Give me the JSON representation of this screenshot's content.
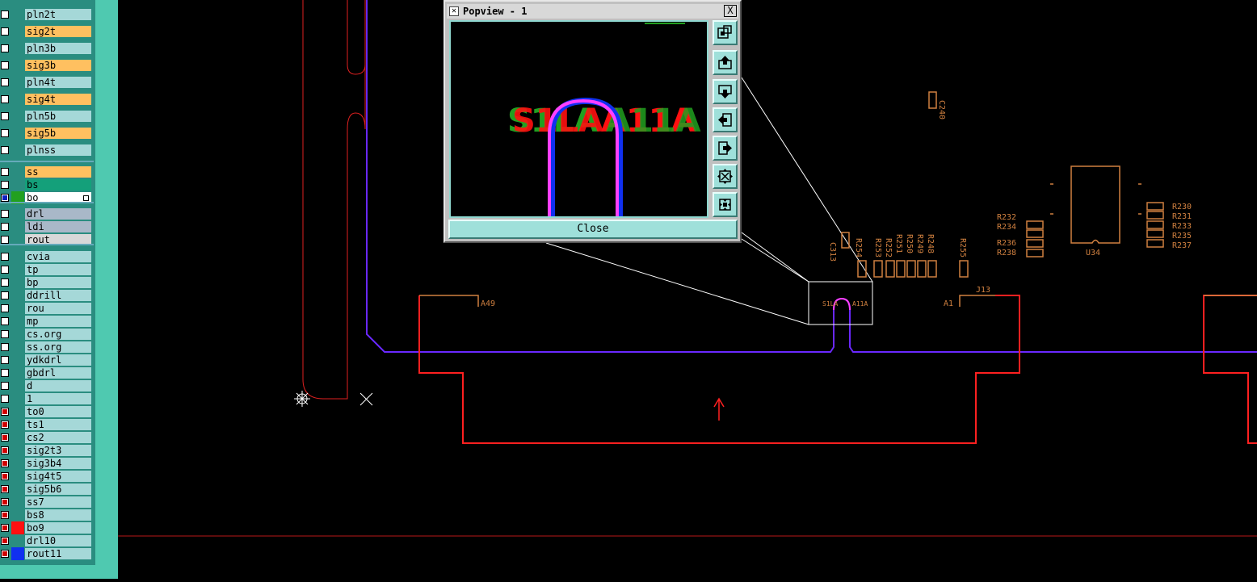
{
  "layers": [
    {
      "name": "pln2t",
      "fill": "#a5d8d8",
      "check": "white"
    },
    {
      "name": "sig2t",
      "fill": "#ffc060",
      "check": "white"
    },
    {
      "name": "pln3b",
      "fill": "#a5d8d8",
      "check": "white"
    },
    {
      "name": "sig3b",
      "fill": "#ffc060",
      "check": "white"
    },
    {
      "name": "pln4t",
      "fill": "#a5d8d8",
      "check": "white"
    },
    {
      "name": "sig4t",
      "fill": "#ffc060",
      "check": "white"
    },
    {
      "name": "pln5b",
      "fill": "#a5d8d8",
      "check": "white"
    },
    {
      "name": "sig5b",
      "fill": "#ffc060",
      "check": "white"
    },
    {
      "name": "plnss",
      "fill": "#a5d8d8",
      "check": "white"
    },
    {
      "name": "ss",
      "fill": "#ffc060",
      "check": "white"
    },
    {
      "name": "bs",
      "fill": "#14a07a",
      "check": "white"
    },
    {
      "name": "bo",
      "fill": "#ffffff",
      "check": "blue",
      "swatch": "#22a020"
    },
    {
      "name": "drl",
      "fill": "#a9b8c8",
      "check": "white"
    },
    {
      "name": "ldi",
      "fill": "#a9b8c8",
      "check": "white"
    },
    {
      "name": "rout",
      "fill": "#d8d8d8",
      "check": "white"
    },
    {
      "name": "cvia",
      "fill": "#a5d8d8",
      "check": "white"
    },
    {
      "name": "tp",
      "fill": "#a5d8d8",
      "check": "white"
    },
    {
      "name": "bp",
      "fill": "#a5d8d8",
      "check": "white"
    },
    {
      "name": "ddrill",
      "fill": "#a5d8d8",
      "check": "white"
    },
    {
      "name": "rou",
      "fill": "#a5d8d8",
      "check": "white"
    },
    {
      "name": "mp",
      "fill": "#a5d8d8",
      "check": "white"
    },
    {
      "name": "cs.org",
      "fill": "#a5d8d8",
      "check": "white"
    },
    {
      "name": "ss.org",
      "fill": "#a5d8d8",
      "check": "white"
    },
    {
      "name": "ydkdrl",
      "fill": "#a5d8d8",
      "check": "white"
    },
    {
      "name": "gbdrl",
      "fill": "#a5d8d8",
      "check": "white"
    },
    {
      "name": "d",
      "fill": "#a5d8d8",
      "check": "white"
    },
    {
      "name": "1",
      "fill": "#a5d8d8",
      "check": "white"
    },
    {
      "name": "to0",
      "fill": "#a5d8d8",
      "check": "red"
    },
    {
      "name": "ts1",
      "fill": "#a5d8d8",
      "check": "red"
    },
    {
      "name": "cs2",
      "fill": "#a5d8d8",
      "check": "red"
    },
    {
      "name": "sig2t3",
      "fill": "#a5d8d8",
      "check": "red"
    },
    {
      "name": "sig3b4",
      "fill": "#a5d8d8",
      "check": "red"
    },
    {
      "name": "sig4t5",
      "fill": "#a5d8d8",
      "check": "red"
    },
    {
      "name": "sig5b6",
      "fill": "#a5d8d8",
      "check": "red"
    },
    {
      "name": "ss7",
      "fill": "#a5d8d8",
      "check": "red"
    },
    {
      "name": "bs8",
      "fill": "#a5d8d8",
      "check": "red"
    },
    {
      "name": "bo9",
      "fill": "#a5d8d8",
      "check": "red",
      "swatch": "#ff1010"
    },
    {
      "name": "drl10",
      "fill": "#a5d8d8",
      "check": "red"
    },
    {
      "name": "rout11",
      "fill": "#a5d8d8",
      "check": "red",
      "swatch": "#1030f0"
    }
  ],
  "popview": {
    "title": "Popview - 1",
    "close_label": "Close",
    "close_x": "X",
    "tools": [
      "zoom-fit-icon",
      "pan-up-icon",
      "pan-down-icon",
      "pan-left-icon",
      "pan-right-icon",
      "zoom-in-icon",
      "zoom-out-icon"
    ],
    "view_text_left": "S1LA",
    "view_text_right": "A11A"
  },
  "board": {
    "colors": {
      "outline": "#ff2020",
      "trace": "#6a28ff",
      "pink": "#ff40ff",
      "silk": "#d08040",
      "pad": "#c8a040"
    },
    "labels": {
      "c240": "C240",
      "c313": "C313",
      "r254": "R254",
      "r253": "R253",
      "r252": "R252",
      "r251": "R251",
      "r250": "R250",
      "r249": "R249",
      "r248": "R248",
      "r255": "R255",
      "r232": "R232",
      "r234": "R234",
      "r236": "R236",
      "r238": "R238",
      "r230": "R230",
      "r231": "R231",
      "r233": "R233",
      "r235": "R235",
      "r237": "R237",
      "u34": "U34",
      "j13": "J13",
      "a1": "A1",
      "a49": "A49",
      "zoom_left": "S1LA",
      "zoom_right": "A11A"
    }
  }
}
